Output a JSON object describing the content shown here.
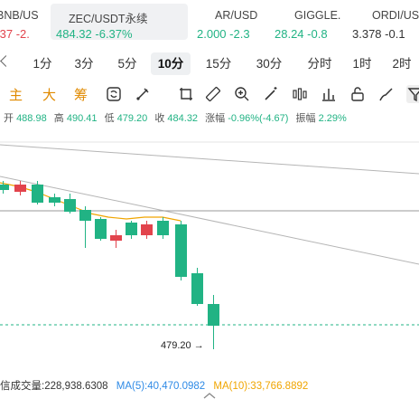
{
  "tickers": [
    {
      "name": "BNB/US",
      "price": ".37",
      "change": "-2.",
      "dir": "down",
      "active": false
    },
    {
      "name": "ZEC/USDT永续",
      "price": "484.32",
      "change": "-6.37%",
      "dir": "up",
      "active": true
    },
    {
      "name": "AR/USD",
      "price": "2.000",
      "change": "-2.3",
      "dir": "up",
      "active": false
    },
    {
      "name": "GIGGLE.",
      "price": "28.24",
      "change": "-0.8",
      "dir": "up",
      "active": false
    },
    {
      "name": "ORDI/US",
      "price": "3.378",
      "change": "-0.1",
      "dir": "neutral",
      "active": false
    }
  ],
  "intervals": {
    "items": [
      "1分",
      "3分",
      "5分",
      "10分",
      "15分",
      "30分",
      "分时",
      "1时",
      "2时"
    ],
    "active_index": 3
  },
  "toolbar": {
    "labels": [
      "主",
      "大",
      "筹"
    ],
    "icons": [
      "refresh-icon",
      "pen-icon",
      "crop-icon",
      "ruler-icon",
      "zoom-in-icon",
      "magic-wand-icon",
      "candle-bars-icon",
      "bar-chart-icon",
      "lock-icon",
      "paintbrush-icon",
      "magnet-icon",
      "filter-icon"
    ]
  },
  "ohlc": {
    "open_label": "开",
    "open": "488.98",
    "high_label": "高",
    "high": "490.41",
    "low_label": "低",
    "low": "479.20",
    "close_label": "收",
    "close": "484.32",
    "change_label": "涨幅",
    "change": "-0.96%(-4.67)",
    "amp_label": "振幅",
    "amp": "2.29%"
  },
  "chart": {
    "low_marker": "479.20",
    "colors": {
      "up": "#e2434c",
      "down": "#21b384",
      "ma": "#f0a500",
      "dash": "#21b384",
      "trend": "#b5b5b5"
    }
  },
  "volume": {
    "label": "信成交量:228,938.6308",
    "ma5": "MA(5):40,470.0982",
    "ma10": "MA(10):33,766.8892"
  }
}
